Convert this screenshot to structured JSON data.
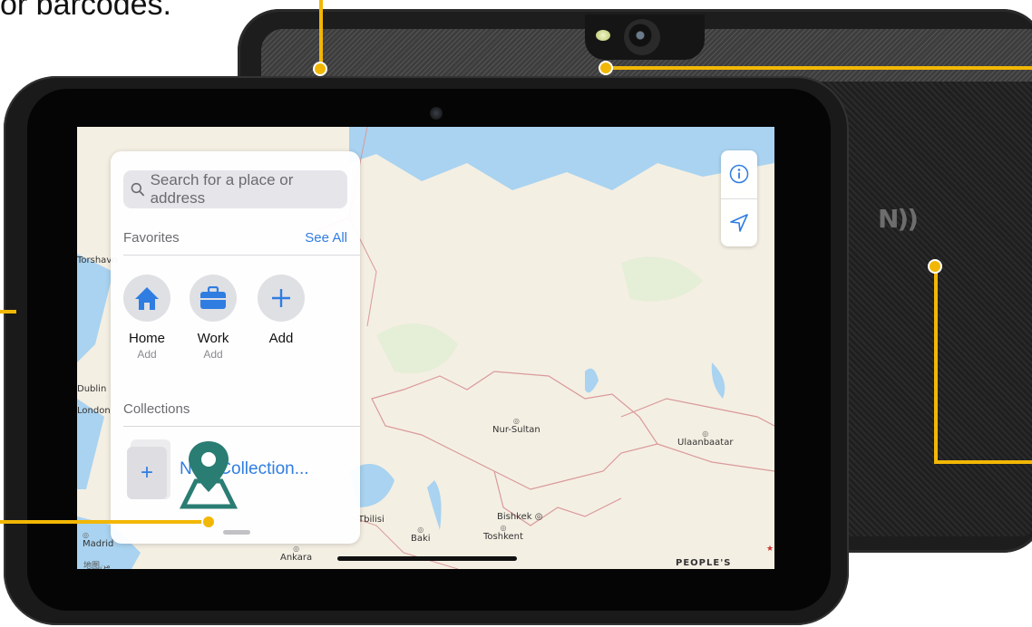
{
  "caption": {
    "text": "or barcodes."
  },
  "device": {
    "nfc_label": "N))"
  },
  "search": {
    "placeholder": "Search for a place or address"
  },
  "favorites": {
    "header": "Favorites",
    "see_all": "See All",
    "items": [
      {
        "name": "Home",
        "sub": "Add",
        "icon": "home-icon",
        "color": "#2f7de1"
      },
      {
        "name": "Work",
        "sub": "Add",
        "icon": "briefcase-icon",
        "color": "#2f7de1"
      },
      {
        "name": "Add",
        "sub": "",
        "icon": "plus-icon",
        "color": "#2f7de1"
      }
    ]
  },
  "collections": {
    "header": "Collections",
    "new_label": "New Collection...",
    "add_glyph": "+"
  },
  "map": {
    "cities": [
      {
        "name": "Nur-Sultan"
      },
      {
        "name": "Ulaanbaatar"
      },
      {
        "name": "Bishkek"
      },
      {
        "name": "Toshkent"
      },
      {
        "name": "Ankara"
      },
      {
        "name": "Madrid"
      },
      {
        "name": "Dublin"
      },
      {
        "name": "London"
      },
      {
        "name": "Tbilisi"
      },
      {
        "name": "Baki"
      },
      {
        "name": "PEOPLE'S"
      },
      {
        "name": "Torshavn"
      }
    ],
    "maps_logo": "地图من",
    "legal_mark": "★"
  },
  "map_controls": {
    "info": "info-icon",
    "location": "location-arrow-icon"
  },
  "colors": {
    "accent": "#2f7de1",
    "callout": "#f2b705",
    "pin": "#2a7d73"
  }
}
